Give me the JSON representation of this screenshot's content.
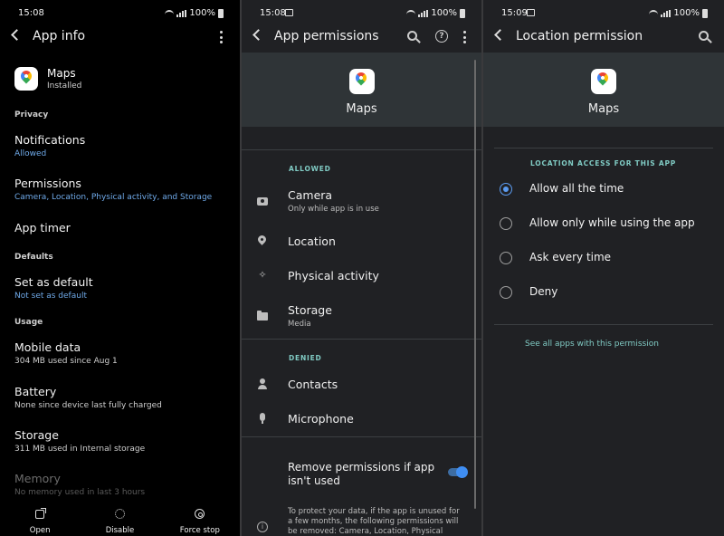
{
  "panel1": {
    "status_time": "15:08",
    "battery": "100%",
    "title": "App info",
    "app_name": "Maps",
    "app_status": "Installed",
    "sec_privacy": "Privacy",
    "notifications": {
      "title": "Notifications",
      "sub": "Allowed"
    },
    "permissions": {
      "title": "Permissions",
      "sub": "Camera, Location, Physical activity, and Storage"
    },
    "app_timer": {
      "title": "App timer"
    },
    "sec_defaults": "Defaults",
    "set_default": {
      "title": "Set as default",
      "sub": "Not set as default"
    },
    "sec_usage": "Usage",
    "mobile_data": {
      "title": "Mobile data",
      "sub": "304 MB used since Aug 1"
    },
    "battery_item": {
      "title": "Battery",
      "sub": "None since device last fully charged"
    },
    "storage": {
      "title": "Storage",
      "sub": "311 MB used in Internal storage"
    },
    "memory": {
      "title": "Memory",
      "sub": "No memory used in last 3 hours"
    },
    "bottom": {
      "open": "Open",
      "disable": "Disable",
      "force_stop": "Force stop"
    }
  },
  "panel2": {
    "status_time": "15:08",
    "battery": "100%",
    "title": "App permissions",
    "help_glyph": "?",
    "app_name": "Maps",
    "allowed_label": "ALLOWED",
    "camera": {
      "title": "Camera",
      "sub": "Only while app is in use"
    },
    "location": {
      "title": "Location"
    },
    "activity": {
      "title": "Physical activity"
    },
    "storage": {
      "title": "Storage",
      "sub": "Media"
    },
    "denied_label": "DENIED",
    "contacts": {
      "title": "Contacts"
    },
    "microphone": {
      "title": "Microphone"
    },
    "remove_perms": "Remove permissions if app isn't used",
    "remove_perms_on": true,
    "info_glyph": "i",
    "info_text": "To protect your data, if the app is unused for a few months, the following permissions will be removed: Camera, Location, Physical activity,"
  },
  "panel3": {
    "status_time": "15:09",
    "battery": "100%",
    "title": "Location permission",
    "app_name": "Maps",
    "section_label": "LOCATION ACCESS FOR THIS APP",
    "options": [
      "Allow all the time",
      "Allow only while using the app",
      "Ask every time",
      "Deny"
    ],
    "selected_index": 0,
    "see_all": "See all apps with this permission"
  },
  "colors": {
    "accent_blue": "#5b9bf0",
    "teal": "#80cbc4",
    "link_blue": "#6fa9e8"
  }
}
